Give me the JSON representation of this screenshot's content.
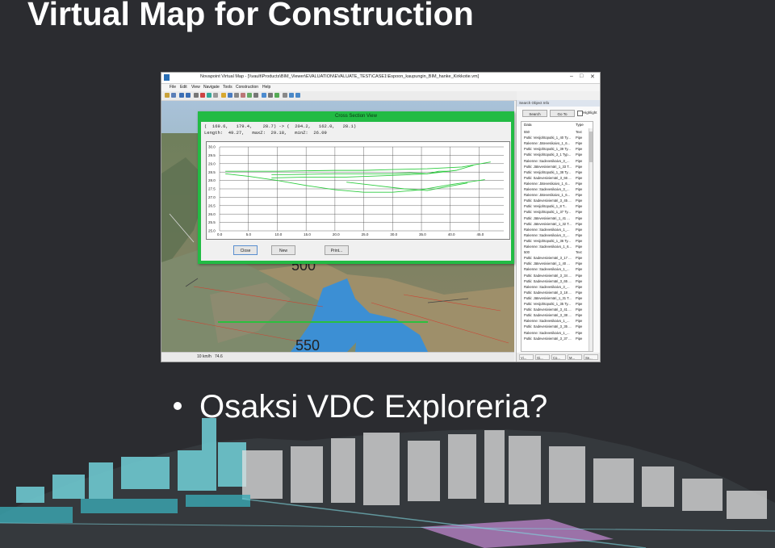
{
  "slide": {
    "title": "Virtual Map for Construction",
    "bullet": "Osaksi VDC Exploreria?"
  },
  "window": {
    "title": "Novapoint Virtual Map - [\\\\vault\\Products\\BIM_Viewer\\EVALUATION\\EVALUATE_TEST\\CASE1\\Espoon_kaupungin_BIM_hanke_Kirkkotie.vm]",
    "menu": [
      "File",
      "Edit",
      "View",
      "Navigate",
      "Tools",
      "Construction",
      "Help"
    ],
    "status": {
      "speed": "10 km/h",
      "value": "74.6"
    }
  },
  "scene_labels": {
    "label1": "500",
    "label2": "550"
  },
  "dialog": {
    "title": "Cross Section View",
    "line1": "(  169.6,   179.4,    28.7) -> (  204.2,   162.0,   28.1)",
    "line2": "Length:  49.27,   maxZ:  29.18,   minZ:  26.09",
    "buttons": {
      "close": "Close",
      "new": "New",
      "print": "Print..."
    }
  },
  "chart_data": {
    "type": "line",
    "title": "",
    "xlabel": "",
    "ylabel": "",
    "xlim": [
      0,
      49.27
    ],
    "ylim": [
      25.0,
      30.0
    ],
    "x_ticks": [
      "0.0",
      "5.0",
      "10.0",
      "15.0",
      "20.0",
      "25.0",
      "30.0",
      "35.0",
      "40.0",
      "45.0"
    ],
    "y_ticks": [
      "30.0",
      "29.5",
      "29.0",
      "28.5",
      "28.0",
      "27.5",
      "27.0",
      "26.5",
      "26.0",
      "25.5",
      "25.0"
    ],
    "grid": true,
    "line_color": "#2ecc40",
    "series": [
      {
        "x": [
          1,
          10,
          20,
          25,
          30,
          36,
          42,
          47
        ],
        "y": [
          28.55,
          28.55,
          28.6,
          28.6,
          28.65,
          28.7,
          28.8,
          29.1
        ]
      },
      {
        "x": [
          1,
          5,
          10,
          15,
          20,
          25,
          30,
          35,
          40,
          46
        ],
        "y": [
          28.4,
          28.25,
          28.0,
          27.7,
          27.45,
          27.3,
          27.3,
          27.45,
          27.75,
          28.05
        ]
      },
      {
        "x": [
          22,
          27,
          32,
          36,
          39,
          43
        ],
        "y": [
          27.9,
          27.7,
          27.5,
          27.4,
          27.6,
          27.85
        ]
      },
      {
        "x": [
          9,
          15,
          22,
          30,
          36,
          38,
          40
        ],
        "y": [
          28.15,
          28.2,
          28.2,
          28.3,
          28.4,
          28.55,
          28.55
        ]
      },
      {
        "x": [
          9,
          12,
          20,
          27,
          30,
          33,
          36,
          41,
          44
        ],
        "y": [
          28.35,
          28.35,
          28.4,
          28.4,
          28.4,
          28.45,
          28.4,
          28.6,
          28.9
        ]
      }
    ]
  },
  "side_panel": {
    "title": "Search Object Info",
    "search_button": "Search",
    "goto_button": "Go To",
    "highlight_label": "Highlight",
    "columns": [
      "Data",
      "Type"
    ],
    "rows": [
      {
        "data": "550",
        "type": "Text"
      },
      {
        "data": "Putki: Vesijohtoputki_1_40 Ty...",
        "type": "Pipe"
      },
      {
        "data": "Rakenne: Jätevesikaivo_1_6...",
        "type": "Pipe"
      },
      {
        "data": "Putki: Vesijohtoputki_1_39 Ty...",
        "type": "Pipe"
      },
      {
        "data": "Putki: Vesijohtoputki_3_1 Typ...",
        "type": "Pipe"
      },
      {
        "data": "Rakenne: Sadevesikaivo_3_...",
        "type": "Pipe"
      },
      {
        "data": "Putki: Jätevesiviemäri_1_33 T...",
        "type": "Pipe"
      },
      {
        "data": "Putki: Vesijohtoputki_1_38 Ty...",
        "type": "Pipe"
      },
      {
        "data": "Putki: Sadevesiviemäri_3_66 ...",
        "type": "Pipe"
      },
      {
        "data": "Rakenne: Jätevesikaivo_1_6...",
        "type": "Pipe"
      },
      {
        "data": "Rakenne: Sadevesikaivo_3_...",
        "type": "Pipe"
      },
      {
        "data": "Rakenne: Jätevesikaivo_1_6...",
        "type": "Pipe"
      },
      {
        "data": "Putki: Sadevesiviemäri_3_45 ...",
        "type": "Pipe"
      },
      {
        "data": "Putki: Vesijohtoputki_1_8 T...",
        "type": "Pipe"
      },
      {
        "data": "Putki: Vesijohtoputki_1_37 Ty...",
        "type": "Pipe"
      },
      {
        "data": "Putki: Jätevesiviemäri_1_41 ...",
        "type": "Pipe"
      },
      {
        "data": "Putki: Jätevesiviemäri_1_32 T...",
        "type": "Pipe"
      },
      {
        "data": "Rakenne: Sadevesikaivo_1_...",
        "type": "Pipe"
      },
      {
        "data": "Rakenne: Sadevesikaivo_3_...",
        "type": "Pipe"
      },
      {
        "data": "Putki: Vesijohtoputki_1_36 Ty...",
        "type": "Pipe"
      },
      {
        "data": "Rakenne: Sadevesikaivo_1_6...",
        "type": "Pipe"
      },
      {
        "data": "500",
        "type": "Text"
      },
      {
        "data": "Putki: Sadevesiviemäri_3_17 ...",
        "type": "Pipe"
      },
      {
        "data": "Putki: Jätevesiviemäri_1_40 ...",
        "type": "Pipe"
      },
      {
        "data": "Rakenne: Sadevesikaivo_1_...",
        "type": "Pipe"
      },
      {
        "data": "Putki: Sadevesiviemäri_3_34 ...",
        "type": "Pipe"
      },
      {
        "data": "Putki: Sadevesiviemäri_3_65 ...",
        "type": "Pipe"
      },
      {
        "data": "Rakenne: Sadevesikaivo_3_...",
        "type": "Pipe"
      },
      {
        "data": "Putki: Sadevesiviemäri_3_18 ...",
        "type": "Pipe"
      },
      {
        "data": "Putki: Jätevesiviemäri_1_31 T...",
        "type": "Pipe"
      },
      {
        "data": "Putki: Vesijohtoputki_1_35 Ty...",
        "type": "Pipe"
      },
      {
        "data": "Putki: Sadevesiviemäri_3_41 ...",
        "type": "Pipe"
      },
      {
        "data": "Putki: Sadevesiviemäri_3_38 ...",
        "type": "Pipe"
      },
      {
        "data": "Rakenne: Sadevesikaivo_1_...",
        "type": "Pipe"
      },
      {
        "data": "Putki: Sadevesiviemäri_3_35 ...",
        "type": "Pipe"
      },
      {
        "data": "Rakenne: Sadevesikaivo_1_...",
        "type": "Pipe"
      },
      {
        "data": "Putki: Sadevesiviemäri_3_37 ...",
        "type": "Pipe"
      }
    ],
    "tabs": [
      "Vi...",
      "Gi...",
      "Co...",
      "M...",
      "Se..."
    ]
  }
}
